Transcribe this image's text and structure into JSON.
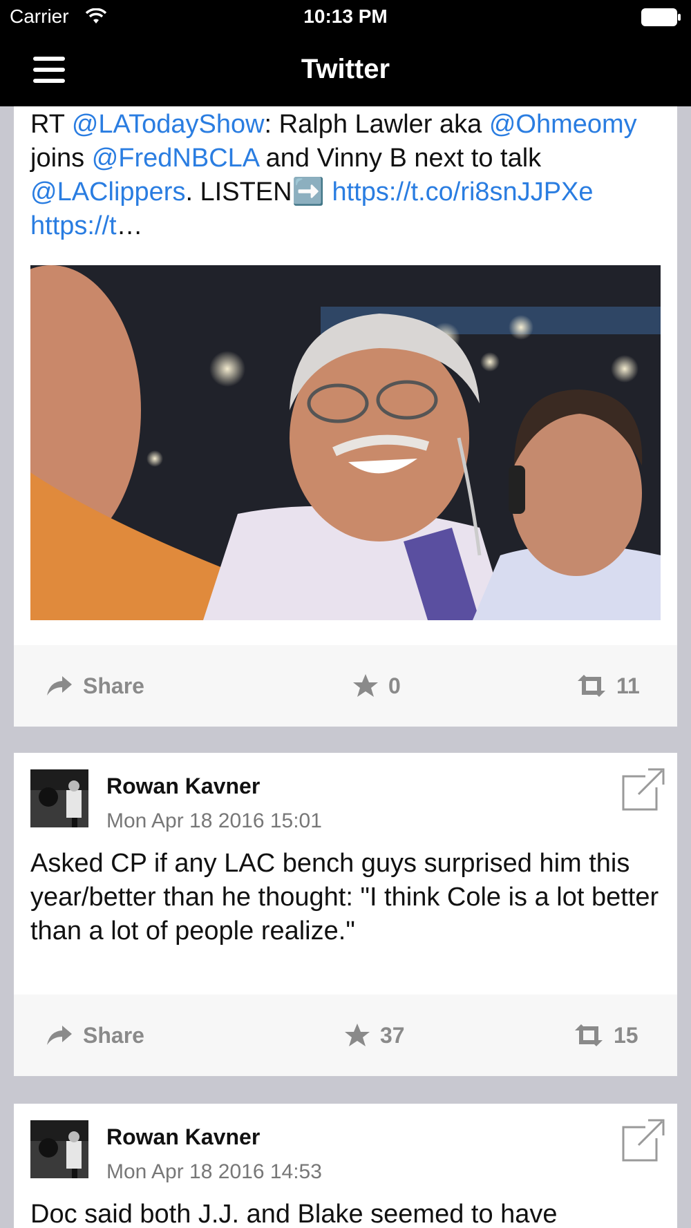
{
  "status_bar": {
    "carrier": "Carrier",
    "time": "10:13 PM"
  },
  "nav": {
    "title": "Twitter"
  },
  "tweets": [
    {
      "segments": [
        {
          "text": "RT ",
          "link": false
        },
        {
          "text": "@LATodayShow",
          "link": true
        },
        {
          "text": ": Ralph Lawler aka ",
          "link": false
        },
        {
          "text": "@Ohmeomy",
          "link": true
        },
        {
          "text": " joins ",
          "link": false
        },
        {
          "text": "@FredNBCLA",
          "link": true
        },
        {
          "text": " and Vinny B next to talk ",
          "link": false
        },
        {
          "text": "@LAClippers",
          "link": true
        },
        {
          "text": ". LISTEN➡️ ",
          "link": false
        },
        {
          "text": "https://t.co/ri8snJJPXe",
          "link": true
        },
        {
          "text": " ",
          "link": false
        },
        {
          "text": "https://t",
          "link": true
        },
        {
          "text": "…",
          "link": false
        }
      ],
      "share_label": "Share",
      "favorites": "0",
      "retweets": "11"
    },
    {
      "author": "Rowan Kavner",
      "timestamp": "Mon Apr 18 2016 15:01",
      "text": "Asked CP if any LAC bench guys surprised him this year/better than he thought: \"I think Cole is a lot better than a lot of people realize.\"",
      "share_label": "Share",
      "favorites": "37",
      "retweets": "15"
    },
    {
      "author": "Rowan Kavner",
      "timestamp": "Mon Apr 18 2016 14:53",
      "text": "Doc said both J.J. and Blake seemed to have"
    }
  ],
  "colors": {
    "link": "#2a7de1",
    "nav_bg": "#000000",
    "feed_bg": "#c8c8d0",
    "action_text": "#8a8a8a"
  },
  "icons": {
    "menu": "hamburger-icon",
    "share": "share-arrow-icon",
    "favorite": "star-icon",
    "retweet": "retweet-icon",
    "external": "external-link-icon"
  }
}
